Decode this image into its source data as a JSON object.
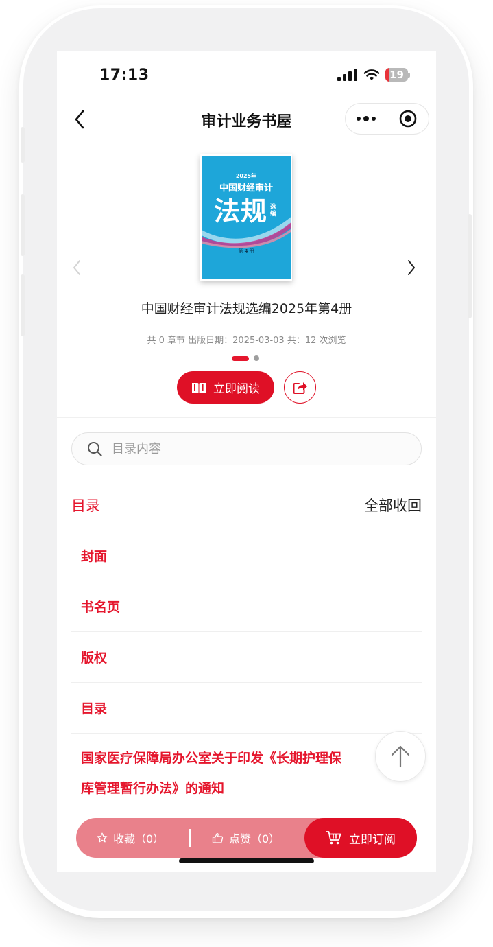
{
  "status_bar": {
    "time": "17:13",
    "battery": "19",
    "battery_level": 0.19
  },
  "nav": {
    "title": "审计业务书屋"
  },
  "book": {
    "cover": {
      "year": "2025年",
      "line1": "中国财经审计",
      "line2": "法规",
      "sub": "选编",
      "vol_num": "4"
    },
    "title": "中国财经审计法规选编2025年第4册",
    "meta": "共 0 章节  出版日期：2025-03-03  共：12 次浏览"
  },
  "carousel": {
    "current": 1,
    "total": 2
  },
  "actions": {
    "read_label": "立即阅读"
  },
  "search": {
    "placeholder": "目录内容"
  },
  "toc": {
    "title": "目录",
    "collapse_label": "全部收回",
    "items": [
      "封面",
      "书名页",
      "版权",
      "目录",
      "国家医疗保障局办公室关于印发《长期护理保险库管理暂行办法》的通知"
    ],
    "item_5_line1": "国家医疗保障局办公室关于印发《长期护理保",
    "item_5_line2": "库管理暂行办法》的通知"
  },
  "bottom_bar": {
    "favorite_label": "收藏（0）",
    "like_label": "点赞（0）",
    "subscribe_label": "立即订阅"
  },
  "colors": {
    "accent": "#df1026",
    "accent_light": "#e9818b",
    "cover_blue": "#1ea6d9"
  },
  "icons": {
    "back": "chevron-left-icon",
    "more": "more-dots-icon",
    "close": "target-circle-icon",
    "book": "open-book-icon",
    "share": "share-icon",
    "search": "search-icon",
    "to_top": "arrow-up-icon",
    "favorite": "star-icon",
    "like": "thumbs-up-icon",
    "cart": "cart-icon"
  }
}
